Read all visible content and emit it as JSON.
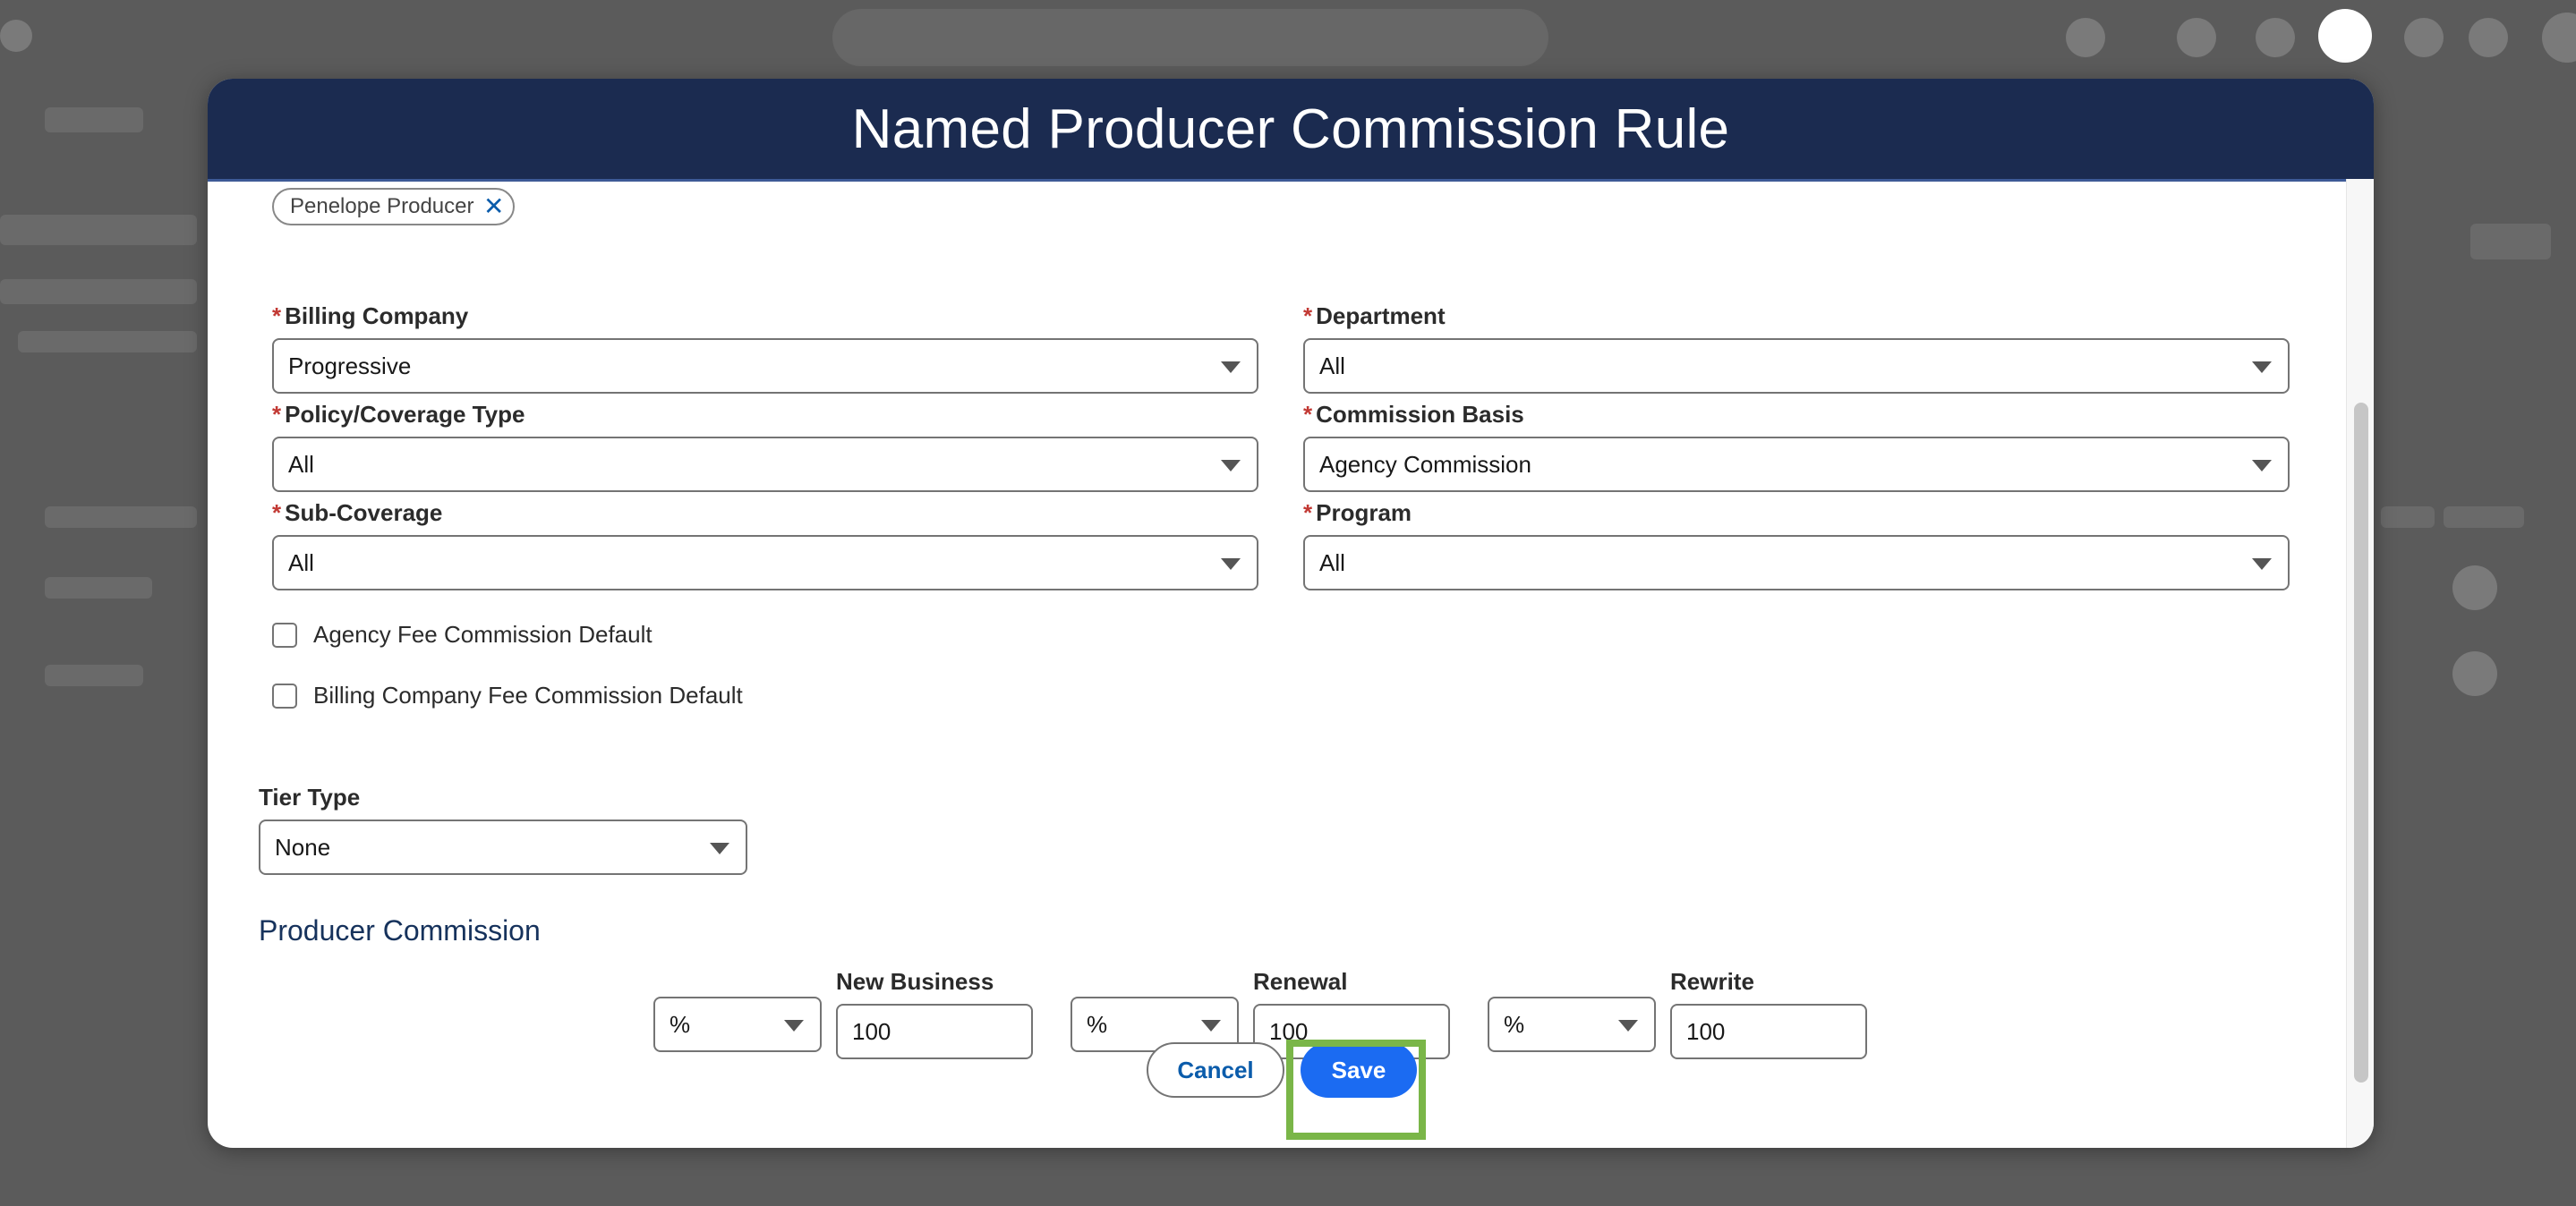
{
  "modal": {
    "title": "Named Producer Commission Rule"
  },
  "selected_producer": {
    "label": "Penelope Producer",
    "remove_glyph": "✕"
  },
  "fields": {
    "billing_company": {
      "label": "Billing Company",
      "value": "Progressive",
      "required": "*"
    },
    "department": {
      "label": "Department",
      "value": "All",
      "required": "*"
    },
    "policy_coverage_type": {
      "label": "Policy/Coverage Type",
      "value": "All",
      "required": "*"
    },
    "commission_basis": {
      "label": "Commission Basis",
      "value": "Agency Commission",
      "required": "*"
    },
    "sub_coverage": {
      "label": "Sub-Coverage",
      "value": "All",
      "required": "*"
    },
    "program": {
      "label": "Program",
      "value": "All",
      "required": "*"
    }
  },
  "checkboxes": {
    "agency_fee": {
      "label": "Agency Fee Commission Default",
      "checked": false
    },
    "billing_company_fee": {
      "label": "Billing Company Fee Commission Default",
      "checked": false
    }
  },
  "tier_type": {
    "label": "Tier Type",
    "value": "None"
  },
  "producer_commission": {
    "title": "Producer Commission",
    "new_business": {
      "label": "New Business",
      "unit": "%",
      "value": "100"
    },
    "renewal": {
      "label": "Renewal",
      "unit": "%",
      "value": "100"
    },
    "rewrite": {
      "label": "Rewrite",
      "unit": "%",
      "value": "100"
    }
  },
  "buttons": {
    "cancel": "Cancel",
    "save": "Save"
  },
  "colors": {
    "header": "#1b2b50",
    "primary": "#1b6bf2",
    "highlight": "#7ab648",
    "required": "#c23934"
  }
}
